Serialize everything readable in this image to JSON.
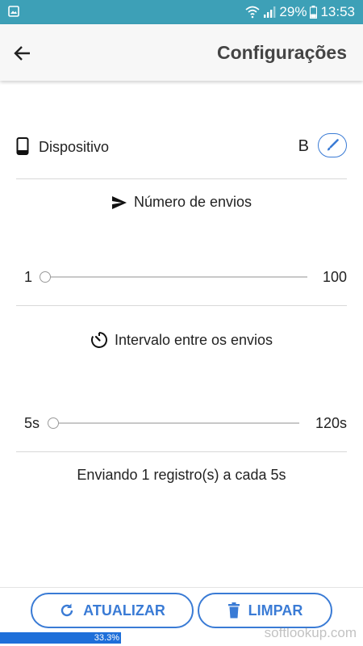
{
  "status_bar": {
    "battery": "29%",
    "time": "13:53"
  },
  "app_bar": {
    "title": "Configurações"
  },
  "device": {
    "label": "Dispositivo",
    "value": "B"
  },
  "sends": {
    "title": "Número de envios",
    "min_label": "1",
    "max_label": "100",
    "value": 1
  },
  "interval": {
    "title": "Intervalo entre os envios",
    "min_label": "5s",
    "max_label": "120s",
    "value": 5
  },
  "summary": "Enviando 1 registro(s) a cada 5s",
  "buttons": {
    "refresh_label": "ATUALIZAR",
    "clear_label": "LIMPAR"
  },
  "progress": {
    "label": "33.3%",
    "value": 0.333
  },
  "watermark": "softlookup.com",
  "colors": {
    "status_bar": "#3da0b7",
    "accent": "#3a7bd5",
    "progress": "#1e6fd9"
  },
  "icons": {
    "back": "arrow-left-icon",
    "device": "smartphone-icon",
    "edit": "brush-icon",
    "send": "send-icon",
    "timer": "timer-icon",
    "refresh": "refresh-icon",
    "clear": "trash-icon"
  }
}
